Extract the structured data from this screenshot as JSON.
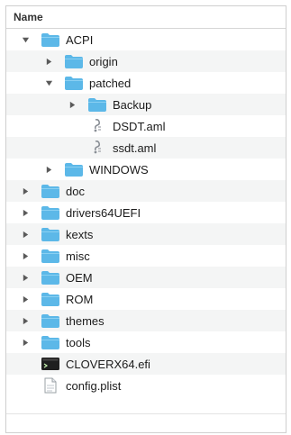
{
  "header": {
    "column_name": "Name"
  },
  "items": [
    {
      "label": "ACPI",
      "type": "folder",
      "depth": 0,
      "toggle": "expanded"
    },
    {
      "label": "origin",
      "type": "folder",
      "depth": 1,
      "toggle": "collapsed"
    },
    {
      "label": "patched",
      "type": "folder",
      "depth": 1,
      "toggle": "expanded"
    },
    {
      "label": "Backup",
      "type": "folder",
      "depth": 2,
      "toggle": "collapsed"
    },
    {
      "label": "DSDT.aml",
      "type": "aml",
      "depth": 2,
      "toggle": "none"
    },
    {
      "label": "ssdt.aml",
      "type": "aml",
      "depth": 2,
      "toggle": "none"
    },
    {
      "label": "WINDOWS",
      "type": "folder",
      "depth": 1,
      "toggle": "collapsed"
    },
    {
      "label": "doc",
      "type": "folder",
      "depth": 0,
      "toggle": "collapsed"
    },
    {
      "label": "drivers64UEFI",
      "type": "folder",
      "depth": 0,
      "toggle": "collapsed"
    },
    {
      "label": "kexts",
      "type": "folder",
      "depth": 0,
      "toggle": "collapsed"
    },
    {
      "label": "misc",
      "type": "folder",
      "depth": 0,
      "toggle": "collapsed"
    },
    {
      "label": "OEM",
      "type": "folder",
      "depth": 0,
      "toggle": "collapsed"
    },
    {
      "label": "ROM",
      "type": "folder",
      "depth": 0,
      "toggle": "collapsed"
    },
    {
      "label": "themes",
      "type": "folder",
      "depth": 0,
      "toggle": "collapsed"
    },
    {
      "label": "tools",
      "type": "folder",
      "depth": 0,
      "toggle": "collapsed"
    },
    {
      "label": "CLOVERX64.efi",
      "type": "exec",
      "depth": 0,
      "toggle": "none"
    },
    {
      "label": "config.plist",
      "type": "plist",
      "depth": 0,
      "toggle": "none"
    }
  ],
  "colors": {
    "folder_fill": "#5cb8e8",
    "folder_tab": "#8ad0f2",
    "toggle": "#5a5a5a"
  }
}
